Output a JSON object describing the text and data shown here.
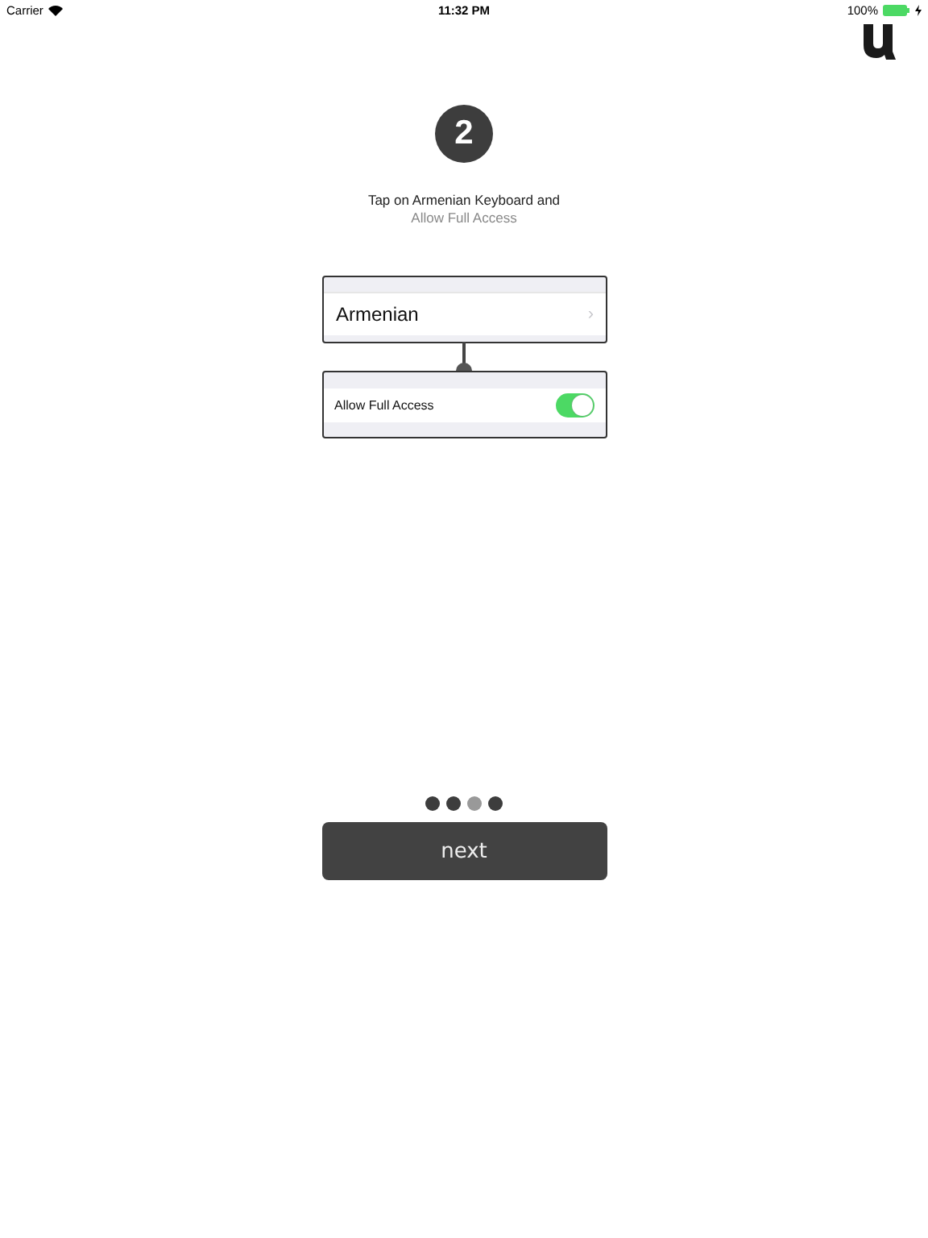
{
  "status_bar": {
    "carrier": "Carrier",
    "time": "11:32 PM",
    "battery": "100%",
    "charging": true
  },
  "step": {
    "number": "2"
  },
  "instruction": {
    "line_1": "Tap on Armenian Keyboard and",
    "line_2": "Allow Full Access"
  },
  "keyboard_row": {
    "label": "Armenian",
    "chevron": "›"
  },
  "access_row": {
    "label": "Allow Full Access",
    "on": true
  },
  "page_dots": [
    {
      "selected": false
    },
    {
      "selected": false
    },
    {
      "selected": true
    },
    {
      "selected": false
    }
  ],
  "next_button": {
    "label": "next"
  }
}
